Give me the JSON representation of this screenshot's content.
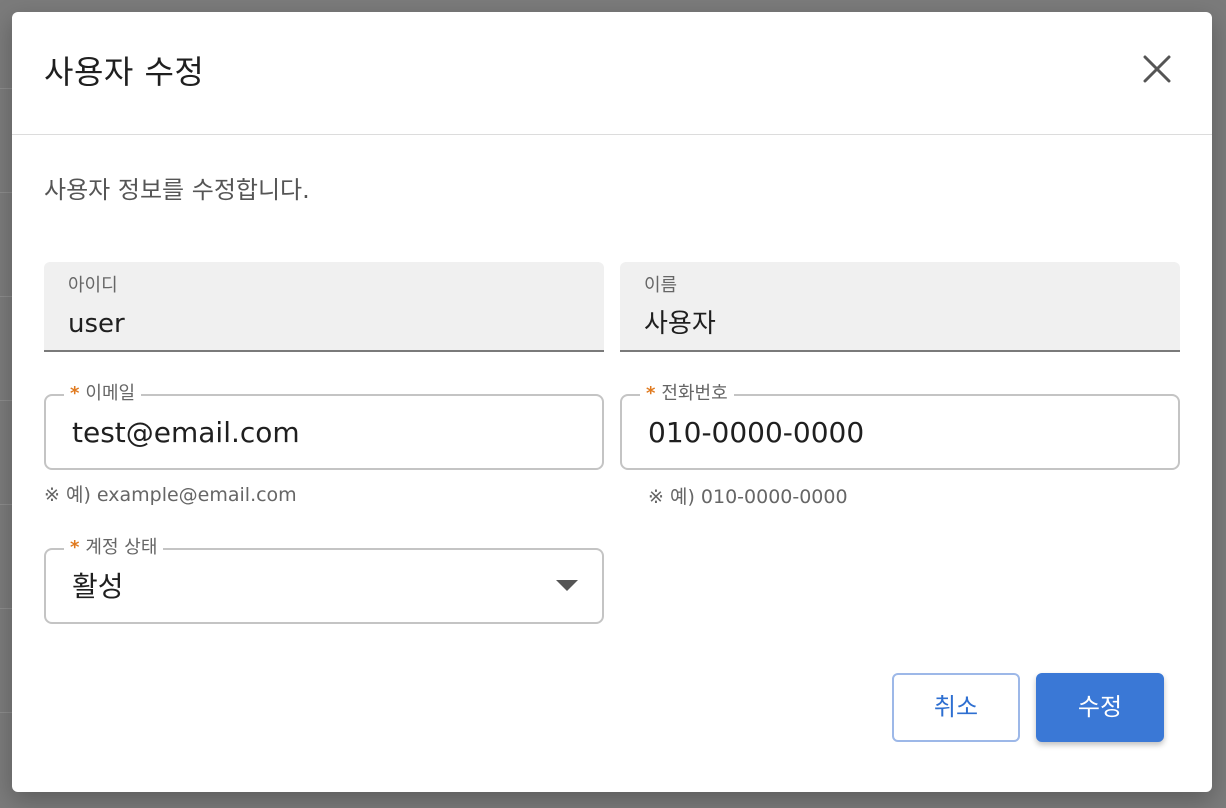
{
  "dialog": {
    "title": "사용자 수정",
    "description": "사용자 정보를 수정합니다."
  },
  "fields": {
    "user_id": {
      "label": "아이디",
      "value": "user"
    },
    "name": {
      "label": "이름",
      "value": "사용자"
    },
    "email": {
      "required_mark": "*",
      "label": "이메일",
      "value": "test@email.com",
      "helper": "※ 예) example@email.com"
    },
    "phone": {
      "required_mark": "*",
      "label": "전화번호",
      "value": "010-0000-0000",
      "helper": "※ 예) 010-0000-0000"
    },
    "status": {
      "required_mark": "*",
      "label": "계정 상태",
      "value": "활성"
    }
  },
  "buttons": {
    "cancel": "취소",
    "submit": "수정"
  },
  "colors": {
    "primary": "#3a78d6",
    "required": "#e07a1f",
    "outline": "#c4c4c4"
  },
  "icons": {
    "close": "close-icon",
    "dropdown": "caret-down-icon"
  }
}
